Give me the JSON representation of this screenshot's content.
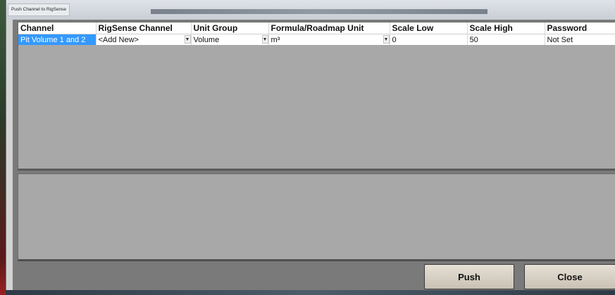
{
  "window": {
    "title": "Push Channel to RigSense"
  },
  "grid": {
    "columns": [
      "Channel",
      "RigSense Channel",
      "Unit Group",
      "Formula/Roadmap Unit",
      "Scale Low",
      "Scale High",
      "Password"
    ],
    "rows": [
      {
        "channel": "Pit Volume 1 and 2",
        "rigsense_channel": "<Add New>",
        "unit_group": "Volume",
        "formula_unit": "m³",
        "scale_low": "0",
        "scale_high": "50",
        "password": "Not Set"
      }
    ]
  },
  "buttons": {
    "push": "Push",
    "close": "Close"
  },
  "colors": {
    "selection": "#3399ff",
    "panel_bg": "#a8a8a8"
  },
  "icons": {
    "dropdown": "chevron-down-icon"
  }
}
